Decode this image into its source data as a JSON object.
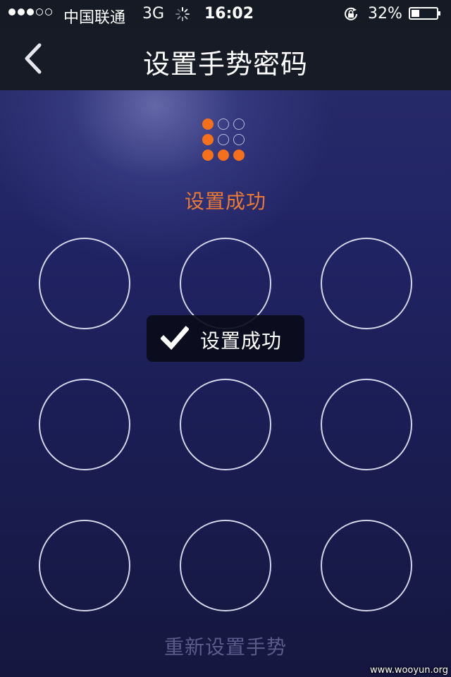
{
  "status_bar": {
    "carrier": "中国联通",
    "network": "3G",
    "time": "16:02",
    "battery_text": "32%",
    "battery_level": 0.32,
    "signal_bars_filled": 3,
    "signal_bars_total": 5
  },
  "nav": {
    "title": "设置手势密码",
    "back_icon": "chevron-left-icon"
  },
  "indicator": {
    "pattern": [
      [
        true,
        false,
        false
      ],
      [
        true,
        false,
        false
      ],
      [
        true,
        true,
        true
      ]
    ],
    "active_color": "#f5701a"
  },
  "status_message": "设置成功",
  "toast": {
    "icon": "checkmark-icon",
    "text": "设置成功"
  },
  "grid": {
    "nodes": 9
  },
  "reset_label": "重新设置手势",
  "watermark": "www.wooyun.org"
}
